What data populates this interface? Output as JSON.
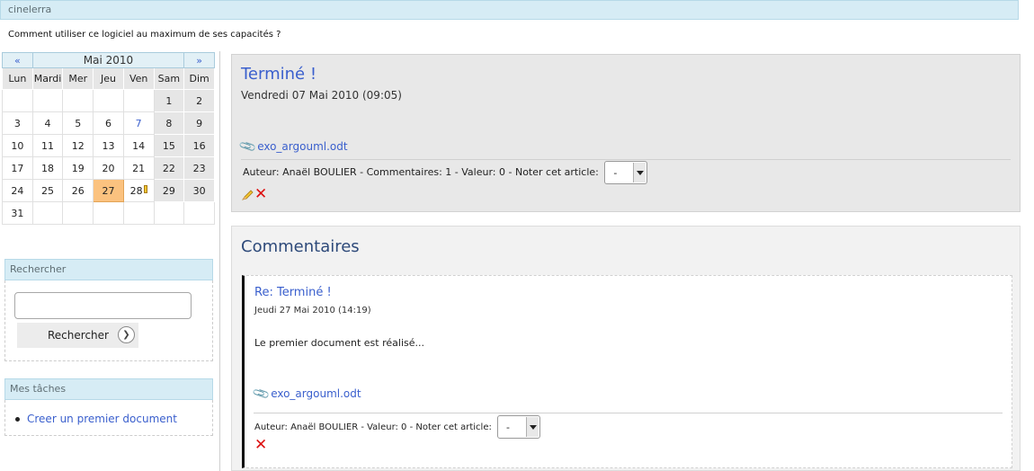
{
  "header": {
    "site_title": "cinelerra",
    "subtitle": "Comment utiliser ce logiciel au maximum de ses capacités ?"
  },
  "calendar": {
    "prev": "«",
    "next": "»",
    "month_label": "Mai 2010",
    "weekdays": [
      "Lun",
      "Mardi",
      "Mer",
      "Jeu",
      "Ven",
      "Sam",
      "Dim"
    ],
    "weeks": [
      [
        "",
        "",
        "",
        "",
        "",
        "1",
        "2"
      ],
      [
        "3",
        "4",
        "5",
        "6",
        "7",
        "8",
        "9"
      ],
      [
        "10",
        "11",
        "12",
        "13",
        "14",
        "15",
        "16"
      ],
      [
        "17",
        "18",
        "19",
        "20",
        "21",
        "22",
        "23"
      ],
      [
        "24",
        "25",
        "26",
        "27",
        "28",
        "29",
        "30"
      ],
      [
        "31",
        "",
        "",
        "",
        "",
        "",
        ""
      ]
    ],
    "today": "27",
    "linked_days": [
      "7"
    ],
    "edited_day": "28",
    "today_color": "#fbc27f"
  },
  "search": {
    "title": "Rechercher",
    "input_value": "",
    "button_label": "Rechercher",
    "button_icon": "arrow-right-circle-icon"
  },
  "tasks": {
    "title": "Mes tâches",
    "items": [
      "Creer un premier document"
    ]
  },
  "article": {
    "title": "Terminé !",
    "date": "Vendredi 07 Mai 2010 (09:05)",
    "attachment": "exo_argouml.odt",
    "meta": "Auteur: Anaël BOULIER - Commentaires: 1 - Valeur: 0 - Noter cet article:",
    "rating_value": "-"
  },
  "comments": {
    "title": "Commentaires",
    "items": [
      {
        "title": "Re: Terminé !",
        "date": "Jeudi 27 Mai 2010 (14:19)",
        "text": "Le premier document est réalisé...",
        "attachment": "exo_argouml.odt",
        "meta": "Auteur: Anaël BOULIER - Valeur: 0 - Noter cet article:",
        "rating_value": "-"
      }
    ]
  },
  "colors": {
    "accent": "#3a5fcd",
    "header_bg": "#d6ecf5",
    "delete": "#dd1111"
  }
}
